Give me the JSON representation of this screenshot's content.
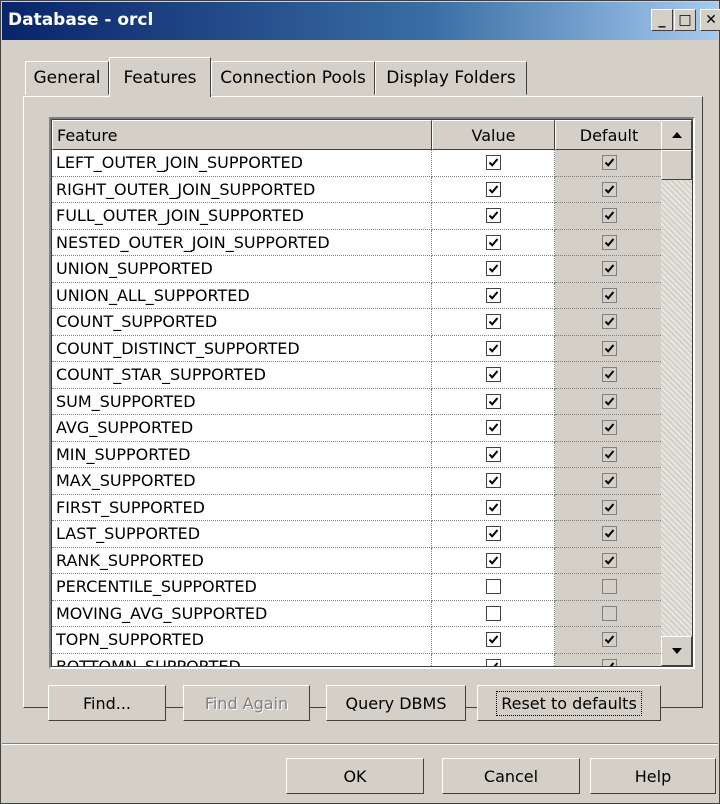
{
  "window": {
    "title": "Database - orcl",
    "min_glyph": "_",
    "max_glyph": "□",
    "close_glyph": "✕"
  },
  "tabs": [
    {
      "label": "General",
      "active": false
    },
    {
      "label": "Features",
      "active": true
    },
    {
      "label": "Connection Pools",
      "active": false
    },
    {
      "label": "Display Folders",
      "active": false
    }
  ],
  "grid": {
    "columns": {
      "feature": "Feature",
      "value": "Value",
      "default": "Default"
    },
    "rows": [
      {
        "feature": "LEFT_OUTER_JOIN_SUPPORTED",
        "value": true,
        "default": true
      },
      {
        "feature": "RIGHT_OUTER_JOIN_SUPPORTED",
        "value": true,
        "default": true
      },
      {
        "feature": "FULL_OUTER_JOIN_SUPPORTED",
        "value": true,
        "default": true
      },
      {
        "feature": "NESTED_OUTER_JOIN_SUPPORTED",
        "value": true,
        "default": true
      },
      {
        "feature": "UNION_SUPPORTED",
        "value": true,
        "default": true
      },
      {
        "feature": "UNION_ALL_SUPPORTED",
        "value": true,
        "default": true
      },
      {
        "feature": "COUNT_SUPPORTED",
        "value": true,
        "default": true
      },
      {
        "feature": "COUNT_DISTINCT_SUPPORTED",
        "value": true,
        "default": true
      },
      {
        "feature": "COUNT_STAR_SUPPORTED",
        "value": true,
        "default": true
      },
      {
        "feature": "SUM_SUPPORTED",
        "value": true,
        "default": true
      },
      {
        "feature": "AVG_SUPPORTED",
        "value": true,
        "default": true
      },
      {
        "feature": "MIN_SUPPORTED",
        "value": true,
        "default": true
      },
      {
        "feature": "MAX_SUPPORTED",
        "value": true,
        "default": true
      },
      {
        "feature": "FIRST_SUPPORTED",
        "value": true,
        "default": true
      },
      {
        "feature": "LAST_SUPPORTED",
        "value": true,
        "default": true
      },
      {
        "feature": "RANK_SUPPORTED",
        "value": true,
        "default": true
      },
      {
        "feature": "PERCENTILE_SUPPORTED",
        "value": false,
        "default": false
      },
      {
        "feature": "MOVING_AVG_SUPPORTED",
        "value": false,
        "default": false
      },
      {
        "feature": "TOPN_SUPPORTED",
        "value": true,
        "default": true
      },
      {
        "feature": "BOTTOMN_SUPPORTED",
        "value": true,
        "default": true
      }
    ]
  },
  "actions": {
    "find": "Find...",
    "find_again": "Find Again",
    "query_dbms": "Query DBMS",
    "reset_defaults": "Reset to defaults"
  },
  "footer": {
    "ok": "OK",
    "cancel": "Cancel",
    "help": "Help"
  }
}
